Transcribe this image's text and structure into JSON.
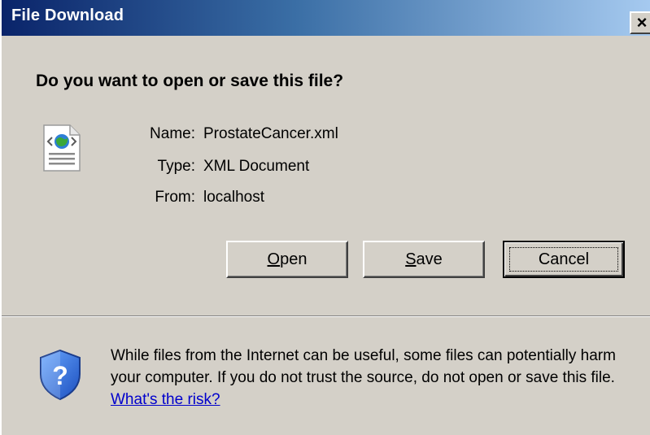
{
  "window": {
    "title": "File Download",
    "close_label": "×"
  },
  "prompt": {
    "question": "Do you want to open or save this file?"
  },
  "file": {
    "icon": "xml-document-icon",
    "name_label": "Name:",
    "name_value": "ProstateCancer.xml",
    "type_label": "Type:",
    "type_value": "XML Document",
    "from_label": "From:",
    "from_value": "localhost"
  },
  "buttons": {
    "open_label": "Open",
    "save_label": "Save",
    "cancel_label": "Cancel"
  },
  "warning": {
    "icon": "shield-question-icon",
    "text": "While files from the Internet can be useful, some files can potentially harm your computer. If you do not trust the source, do not open or save this file.",
    "link_text": "What's the risk?"
  },
  "colors": {
    "title_gradient_start": "#0a246a",
    "title_gradient_end": "#a6caf0",
    "dialog_bg": "#d4d0c8",
    "link": "#0000cc"
  }
}
